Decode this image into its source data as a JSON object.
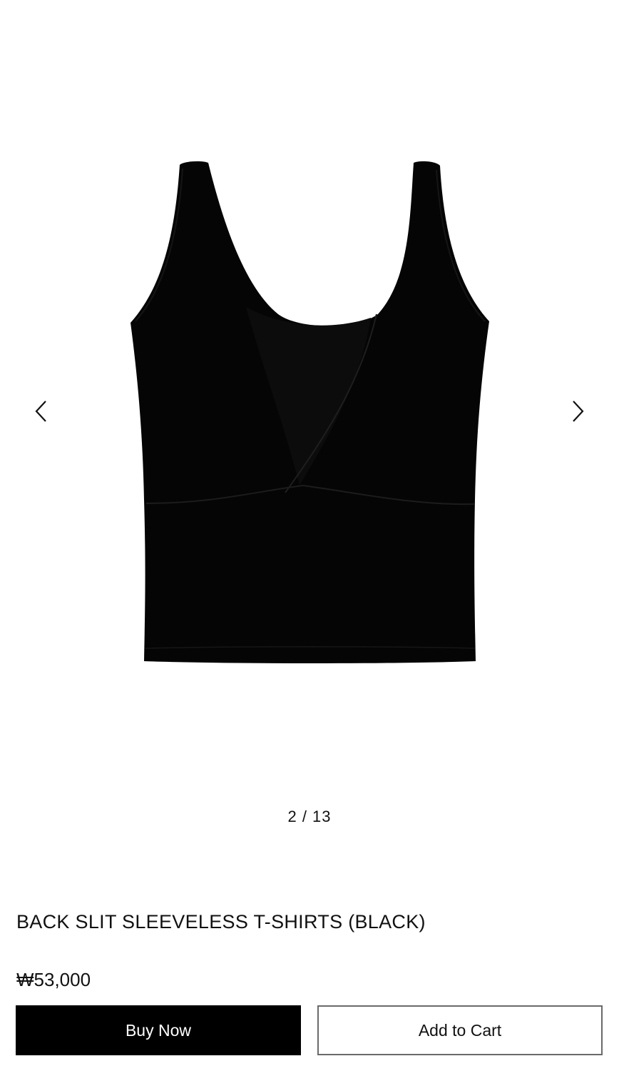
{
  "gallery": {
    "counter": "2 / 13",
    "prev_icon": "chevron-left-icon",
    "next_icon": "chevron-right-icon",
    "image_subject": "black sleeveless top"
  },
  "product": {
    "title": "BACK SLIT SLEEVELESS T-SHIRTS (BLACK)",
    "price": "₩53,000"
  },
  "actions": {
    "buy_label": "Buy Now",
    "cart_label": "Add to Cart"
  },
  "colors": {
    "primary_button_bg": "#000000",
    "primary_button_text": "#ffffff",
    "secondary_button_border": "#6a6a6a",
    "garment": "#050505"
  }
}
